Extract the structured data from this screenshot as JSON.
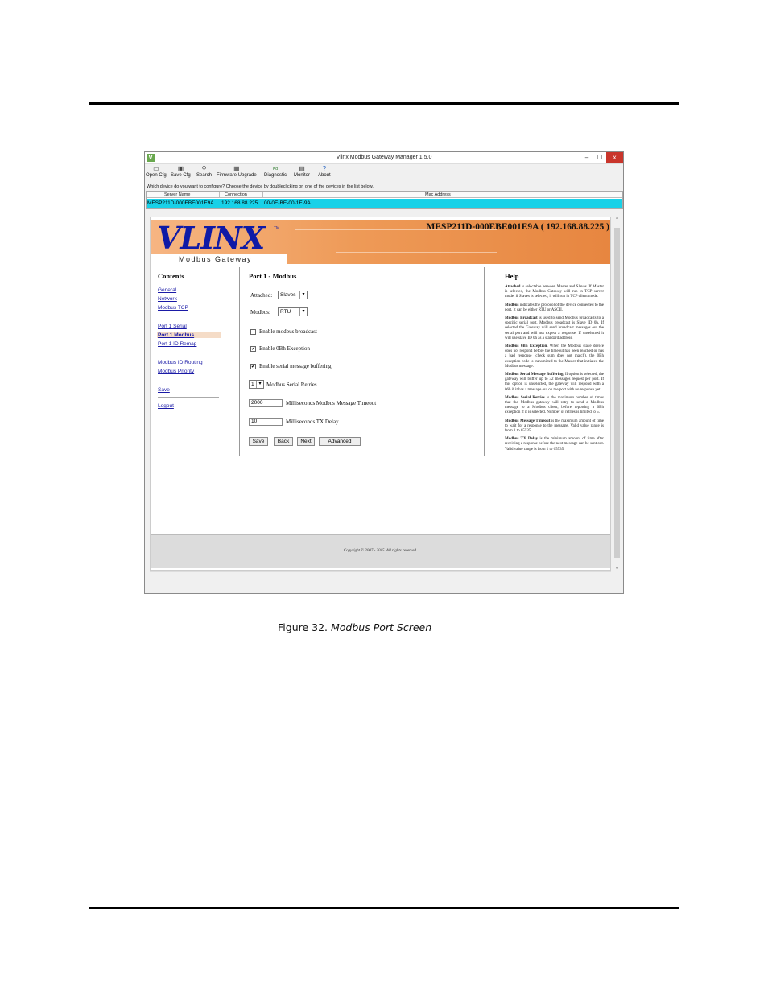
{
  "window": {
    "title": "Vlinx Modbus Gateway Manager 1.5.0",
    "min": "–",
    "max": "☐",
    "close": "x"
  },
  "toolbar": [
    {
      "label": "Open Cfg",
      "icon": "folder-icon",
      "glyph": "▭"
    },
    {
      "label": "Save Cfg",
      "icon": "floppy-icon",
      "glyph": "▣"
    },
    {
      "label": "Search",
      "icon": "search-icon",
      "glyph": "⚲"
    },
    {
      "label": "Firmware Upgrade",
      "icon": "chip-icon",
      "glyph": "▦"
    },
    {
      "label": "Diagnostic",
      "icon": "diagnostic-icon",
      "glyph": "Kd"
    },
    {
      "label": "Monitor",
      "icon": "monitor-icon",
      "glyph": "▤"
    },
    {
      "label": "About",
      "icon": "help-icon",
      "glyph": "?"
    }
  ],
  "prompt": "Which device do you want to configure? Choose the device by doubleclicking on one of the devices in the list below.",
  "device_table": {
    "headers": [
      "Server Name",
      "Connection",
      "Mac Address"
    ],
    "row": {
      "server": "MESP211D-000EBE001E9A",
      "connection": "192.168.88.225",
      "mac": "00-0E-BE-00-1E-9A"
    }
  },
  "banner": {
    "logo": "VLINX",
    "tm": "TM",
    "subtitle": "Modbus Gateway",
    "device_title": "MESP211D-000EBE001E9A ( 192.168.88.225 )"
  },
  "contents": {
    "title": "Contents",
    "links": [
      "General",
      "Network",
      "Modbus TCP",
      "Port 1 Serial",
      "Port 1 Modbus",
      "Port 1 ID Remap",
      "Modbus ID Routing",
      "Modbus Priority",
      "Save",
      "Logout"
    ]
  },
  "form": {
    "title": "Port 1 - Modbus",
    "attached_label": "Attached:",
    "attached_value": "Slaves",
    "modbus_label": "Modbus:",
    "modbus_value": "RTU",
    "broadcast_label": "Enable modbus broadcast",
    "exception_label": "Enable 0Bh Exception",
    "buffering_label": "Enable serial message buffering",
    "checkmark": "✔",
    "retries_value": "1",
    "retries_label": "Modbus Serial Retries",
    "timeout_value": "2000",
    "timeout_label": "Milliseconds Modbus Message Timeout",
    "txdelay_value": "10",
    "txdelay_label": "Milliseconds TX Delay",
    "buttons": [
      "Save",
      "Back",
      "Next",
      "Advanced"
    ],
    "dropdown_glyph": "▾",
    "state": {
      "broadcast": false,
      "exception": true,
      "buffering": true
    }
  },
  "help": {
    "title": "Help",
    "items": [
      {
        "term": "Attached",
        "text": " is selectable between Master and Slaves. If Master is selected, the Modbus Gateway will run in TCP server mode, if Slaves is selected, it will run in TCP client mode."
      },
      {
        "term": "Modbus",
        "text": " indicates the protocol of the device connected to the port. It can be either RTU or ASCII."
      },
      {
        "term": "Modbus Broadcast",
        "text": " is used to send Modbus broadcasts to a specific serial port. Modbus broadcast is Slave ID 0h. If selected the Gateway will send broadcast messages out the serial port and will not expect a response. If unselected it will use slave ID 0h as a standard address."
      },
      {
        "term": "Modbus 0Bh Exception.",
        "text": " When the Modbus slave device does not respond before the timeout has been reached or has a bad response (check sum does not match), the 0Bh exception code is transmitted to the Master that initiated the Modbus message."
      },
      {
        "term": "Modbus Serial Message Buffering.",
        "text": " If option is selected, the gateway will buffer up to 32 messages request per port. If this option is unselected, the gateway will respond with a 06h if it has a message out on the port with no response yet."
      },
      {
        "term": "Modbus Serial Retries",
        "text": " is the maximum number of times that the Modbus gateway will retry to send a Modbus message to a Modbus client, before reporting a 0Bh exception if it is selected. Number of retries is limited to 5."
      },
      {
        "term": "Modbus Message Timeout",
        "text": " is the maximum amount of time to wait for a response to the message. Valid value range is from 1 to 65535."
      },
      {
        "term": "Modbus TX Delay",
        "text": " is the minimum amount of time after receiving a response before the next message can be sent out. Valid value range is from 1 to 65535."
      }
    ]
  },
  "footer": "Copyright © 2007 - 2015. All rights reserved.",
  "scroll": {
    "up": "⌃",
    "down": "⌄"
  },
  "caption": {
    "prefix": "Figure 32. ",
    "title": "Modbus Port Screen"
  }
}
